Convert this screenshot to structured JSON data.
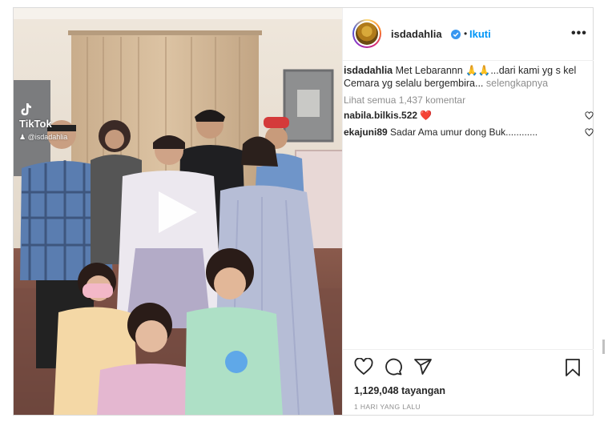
{
  "post": {
    "username": "isdadahlia",
    "follow_label": "Ikuti",
    "dot": "•",
    "more_label": "•••",
    "caption_username": "isdadahlia",
    "caption_text": "Met Lebarannn 🙏🙏...dari kami yg s kel Cemara yg selalu bergembira...",
    "caption_more": "selengkapnya",
    "view_all_comments": "Lihat semua 1,437 komentar",
    "comments": [
      {
        "user": "nabila.bilkis.522",
        "text": "❤️"
      },
      {
        "user": "ekajuni89",
        "text": "Sadar Ama umur dong Buk............"
      }
    ],
    "views": "1,129,048 tayangan",
    "timestamp": "1 HARI YANG LALU"
  },
  "watermark": {
    "brand": "TikTok",
    "handle": "@isdadahlia"
  },
  "colors": {
    "accent": "#0095f6",
    "heart": "#ed4956",
    "text": "#262626",
    "muted": "#8e8e8e"
  },
  "icons": [
    "verified-badge-icon",
    "more-options-icon",
    "tiktok-logo-icon",
    "play-icon",
    "heart-icon",
    "comment-icon",
    "share-icon",
    "bookmark-icon"
  ]
}
